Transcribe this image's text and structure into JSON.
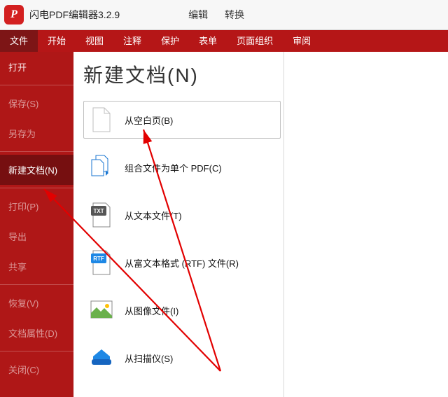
{
  "title": {
    "app_name": "闪电PDF编辑器3.2.9",
    "links": [
      "编辑",
      "转换"
    ]
  },
  "menu": {
    "items": [
      "文件",
      "开始",
      "视图",
      "注释",
      "保护",
      "表单",
      "页面组织",
      "审阅"
    ],
    "active": "文件"
  },
  "sidebar": {
    "items": [
      {
        "label": "打开",
        "dim": false
      },
      {
        "label": "保存(S)",
        "dim": true
      },
      {
        "label": "另存为",
        "dim": true
      },
      {
        "label": "新建文档(N)",
        "dim": false,
        "active": true
      },
      {
        "label": "打印(P)",
        "dim": true
      },
      {
        "label": "导出",
        "dim": true
      },
      {
        "label": "共享",
        "dim": true
      },
      {
        "label": "恢复(V)",
        "dim": true
      },
      {
        "label": "文档属性(D)",
        "dim": true
      },
      {
        "label": "关闭(C)",
        "dim": true
      }
    ]
  },
  "panel": {
    "title": "新建文档(N)",
    "options": [
      {
        "icon": "blank-page-icon",
        "label": "从空白页(B)",
        "active": true
      },
      {
        "icon": "combine-files-icon",
        "label": "组合文件为单个 PDF(C)"
      },
      {
        "icon": "txt-file-icon",
        "label": "从文本文件(T)"
      },
      {
        "icon": "rtf-file-icon",
        "label": "从富文本格式 (RTF) 文件(R)"
      },
      {
        "icon": "image-file-icon",
        "label": "从图像文件(I)"
      },
      {
        "icon": "scanner-icon",
        "label": "从扫描仪(S)"
      }
    ]
  }
}
